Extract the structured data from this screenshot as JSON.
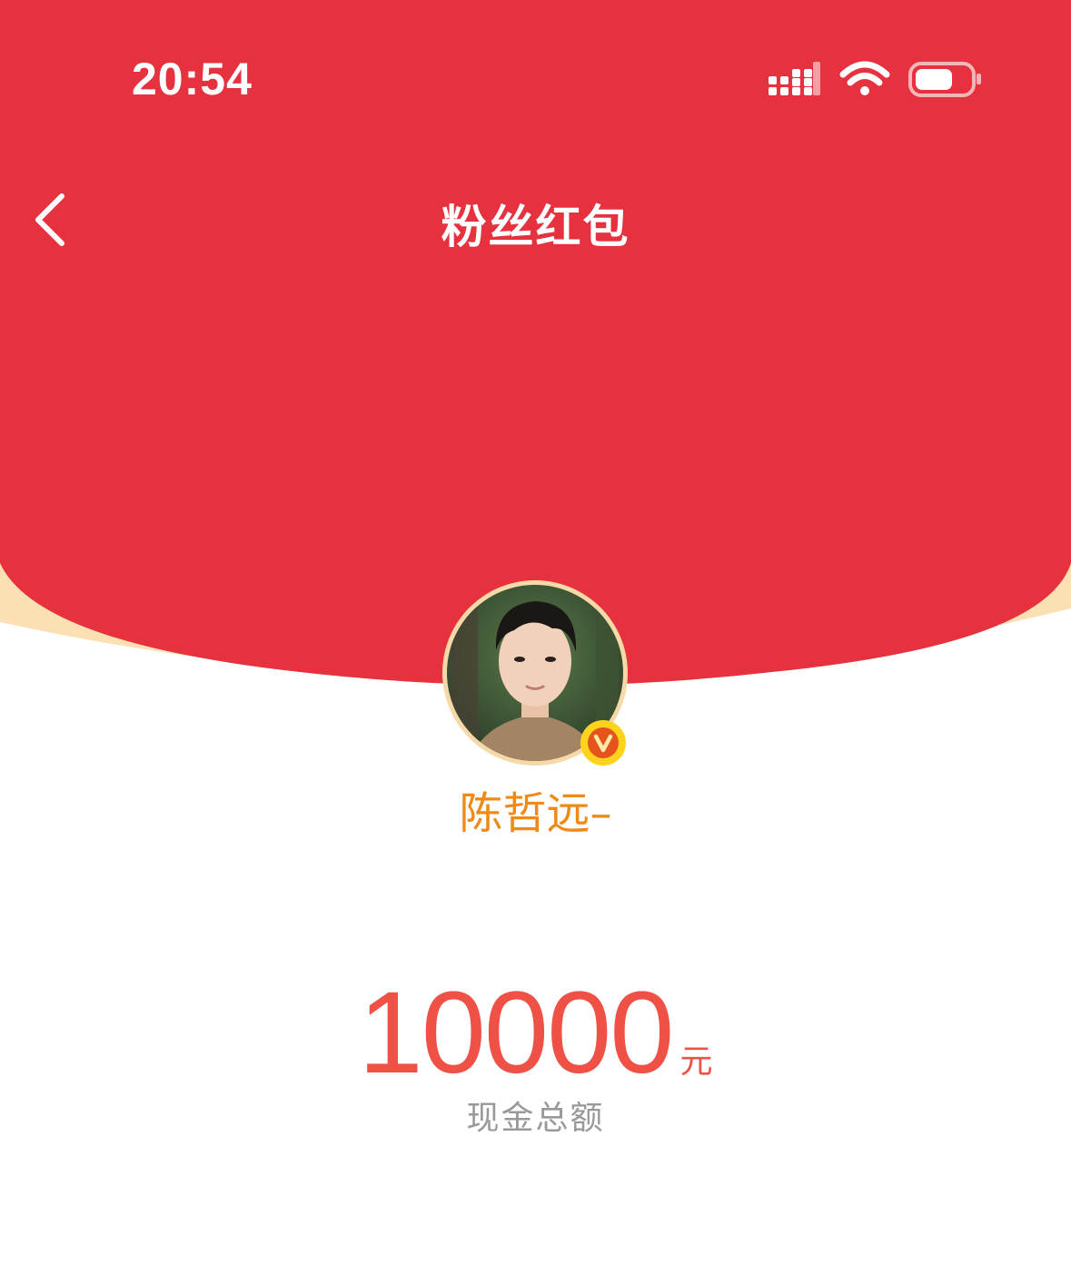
{
  "status_bar": {
    "time": "20:54",
    "icons": [
      "signal-icon",
      "wifi-icon",
      "battery-icon"
    ]
  },
  "nav": {
    "back_icon": "chevron-left-icon",
    "title": "粉丝红包"
  },
  "sender": {
    "name": "陈哲远–",
    "verified_badge": "V"
  },
  "amount": {
    "value": "10000",
    "unit": "元",
    "caption": "现金总额"
  },
  "colors": {
    "header_red": "#E5323E",
    "envelope_gold": "#FBE0B4",
    "name_orange": "#EE8A18",
    "amount_red": "#EF5146",
    "caption_gray": "#999999"
  }
}
